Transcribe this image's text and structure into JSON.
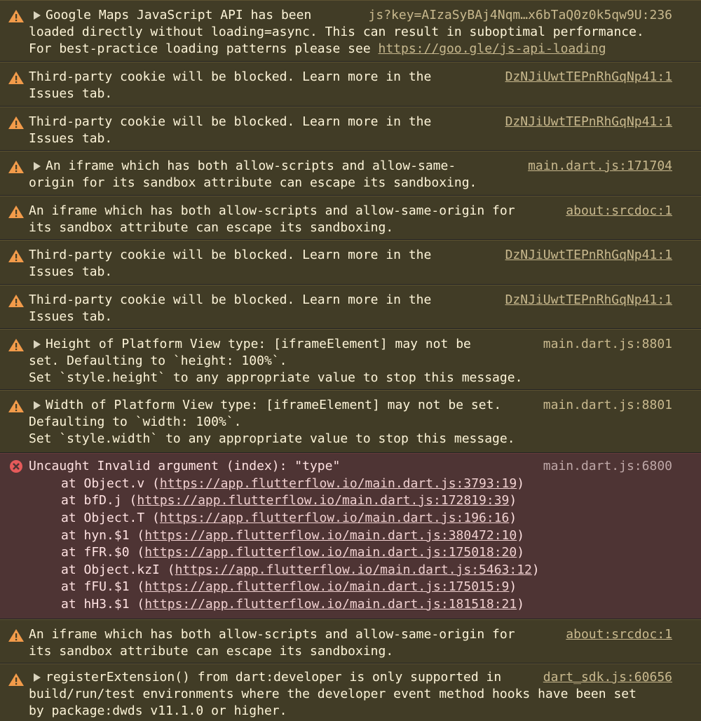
{
  "colors": {
    "warning_bg": "#413c26",
    "warning_text": "#fdf4d8",
    "warning_icon": "#f29b4a",
    "error_bg": "#4e3434",
    "error_text": "#ffe2e2",
    "error_icon": "#e65a5a",
    "source_link": "#c9b98e"
  },
  "messages": [
    {
      "level": "warning",
      "icon": "warning-icon",
      "expandable": true,
      "lines": [
        "Google Maps JavaScript API has been",
        "loaded directly without loading=async. This can result in suboptimal performance.",
        "For best-practice loading patterns please see "
      ],
      "link": "https://goo.gle/js-api-loading",
      "source": "js?key=AIzaSyBAj4Nqm…x6bTaQ0z0k5qw9U:236"
    },
    {
      "level": "warning",
      "icon": "warning-icon",
      "expandable": false,
      "lines": [
        "Third-party cookie will be blocked. Learn more in the",
        "Issues tab."
      ],
      "source": "DzNJiUwtTEPnRhGqNp41:1"
    },
    {
      "level": "warning",
      "icon": "warning-icon",
      "expandable": false,
      "lines": [
        "Third-party cookie will be blocked. Learn more in the",
        "Issues tab."
      ],
      "source": "DzNJiUwtTEPnRhGqNp41:1"
    },
    {
      "level": "warning",
      "icon": "warning-icon",
      "expandable": true,
      "lines": [
        "An iframe which has both allow-scripts and allow-same-",
        "origin for its sandbox attribute can escape its sandboxing."
      ],
      "source": "main.dart.js:171704"
    },
    {
      "level": "warning",
      "icon": "warning-icon",
      "expandable": false,
      "lines": [
        "An iframe which has both allow-scripts and allow-same-origin for",
        "its sandbox attribute can escape its sandboxing."
      ],
      "source": "about:srcdoc:1"
    },
    {
      "level": "warning",
      "icon": "warning-icon",
      "expandable": false,
      "lines": [
        "Third-party cookie will be blocked. Learn more in the",
        "Issues tab."
      ],
      "source": "DzNJiUwtTEPnRhGqNp41:1"
    },
    {
      "level": "warning",
      "icon": "warning-icon",
      "expandable": false,
      "lines": [
        "Third-party cookie will be blocked. Learn more in the",
        "Issues tab."
      ],
      "source": "DzNJiUwtTEPnRhGqNp41:1"
    },
    {
      "level": "warning",
      "icon": "warning-icon",
      "expandable": true,
      "lines": [
        "Height of Platform View type: [iframeElement] may not be",
        "set. Defaulting to `height: 100%`.",
        "Set `style.height` to any appropriate value to stop this message."
      ],
      "source": "main.dart.js:8801"
    },
    {
      "level": "warning",
      "icon": "warning-icon",
      "expandable": true,
      "lines": [
        "Width of Platform View type: [iframeElement] may not be set.",
        "Defaulting to `width: 100%`.",
        "Set `style.width` to any appropriate value to stop this message."
      ],
      "source": "main.dart.js:8801"
    },
    {
      "level": "error",
      "icon": "error-icon",
      "expandable": false,
      "lines": [
        "Uncaught Invalid argument (index): \"type\""
      ],
      "source": "main.dart.js:6800",
      "stack": [
        {
          "prefix": "at Object.v (",
          "url": "https://app.flutterflow.io/main.dart.js:3793:19",
          "suffix": ")"
        },
        {
          "prefix": "at bfD.j (",
          "url": "https://app.flutterflow.io/main.dart.js:172819:39",
          "suffix": ")"
        },
        {
          "prefix": "at Object.T (",
          "url": "https://app.flutterflow.io/main.dart.js:196:16",
          "suffix": ")"
        },
        {
          "prefix": "at hyn.$1 (",
          "url": "https://app.flutterflow.io/main.dart.js:380472:10",
          "suffix": ")"
        },
        {
          "prefix": "at fFR.$0 (",
          "url": "https://app.flutterflow.io/main.dart.js:175018:20",
          "suffix": ")"
        },
        {
          "prefix": "at Object.kzI (",
          "url": "https://app.flutterflow.io/main.dart.js:5463:12",
          "suffix": ")"
        },
        {
          "prefix": "at fFU.$1 (",
          "url": "https://app.flutterflow.io/main.dart.js:175015:9",
          "suffix": ")"
        },
        {
          "prefix": "at hH3.$1 (",
          "url": "https://app.flutterflow.io/main.dart.js:181518:21",
          "suffix": ")"
        }
      ]
    },
    {
      "level": "warning",
      "icon": "warning-icon",
      "expandable": false,
      "lines": [
        "An iframe which has both allow-scripts and allow-same-origin for",
        "its sandbox attribute can escape its sandboxing."
      ],
      "source": "about:srcdoc:1"
    },
    {
      "level": "warning",
      "icon": "warning-icon",
      "expandable": true,
      "lines": [
        "registerExtension() from dart:developer is only supported in",
        "build/run/test environments where the developer event method hooks have been set",
        "by package:dwds v11.1.0 or higher."
      ],
      "source": "dart_sdk.js:60656"
    }
  ]
}
